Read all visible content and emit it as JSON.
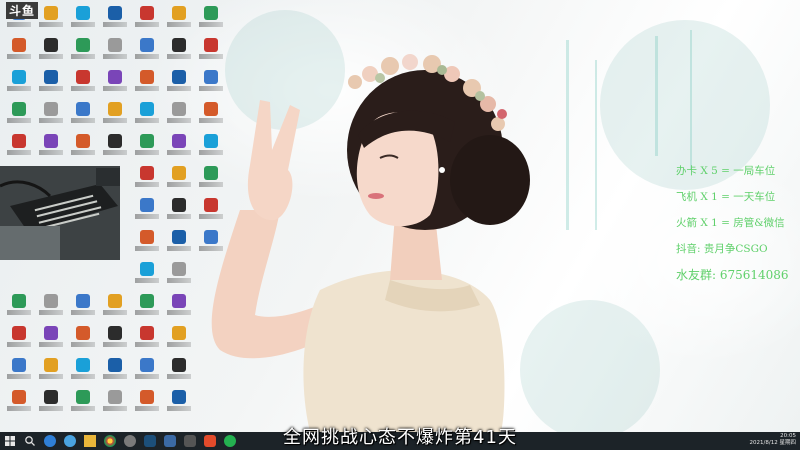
{
  "overlay": {
    "logo": "斗鱼",
    "promo_lines": [
      "办卡 X 5 = 一局车位",
      "飞机 X 1 = 一天车位",
      "火箭 X 1 = 房管&微信",
      "抖音: 贵月争CSGO",
      "水友群: 675614086"
    ],
    "subtitle": "全网挑战心态不爆炸第41天"
  },
  "taskbar": {
    "time": "20:05",
    "date": "2021/8/12 星期四"
  },
  "colors": {
    "promo": "#5fd06a",
    "taskbar": "#1c2328"
  }
}
